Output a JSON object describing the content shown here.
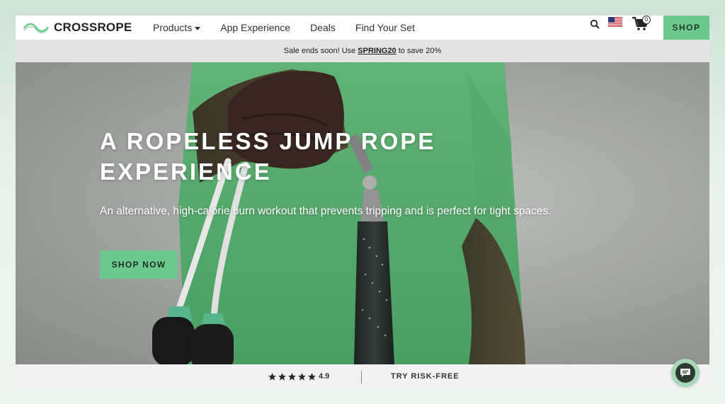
{
  "brand": {
    "name": "CROSSROPE"
  },
  "nav": {
    "items": [
      {
        "label": "Products",
        "has_dropdown": true
      },
      {
        "label": "App Experience"
      },
      {
        "label": "Deals"
      },
      {
        "label": "Find Your Set"
      }
    ]
  },
  "header": {
    "cart_count": "0",
    "shop_label": "SHOP",
    "icons": [
      "search-icon",
      "us-flag-icon",
      "cart-icon"
    ]
  },
  "promo": {
    "prefix": "Sale ends soon! Use",
    "code": "SPRING20",
    "suffix": "to save 20%"
  },
  "hero": {
    "title_line1": "A ROPELESS JUMP ROPE",
    "title_line2": "EXPERIENCE",
    "subtitle": "An alternative, high-calorie burn workout that prevents tripping and is perfect for tight spaces.",
    "cta_label": "SHOP NOW"
  },
  "strip": {
    "rating": "4.9",
    "stars": 5,
    "risk_label": "TRY RISK-FREE"
  },
  "colors": {
    "accent": "#6dc88e",
    "promo_bg": "#e4e4e4",
    "shirt_green": "#5fb877"
  }
}
